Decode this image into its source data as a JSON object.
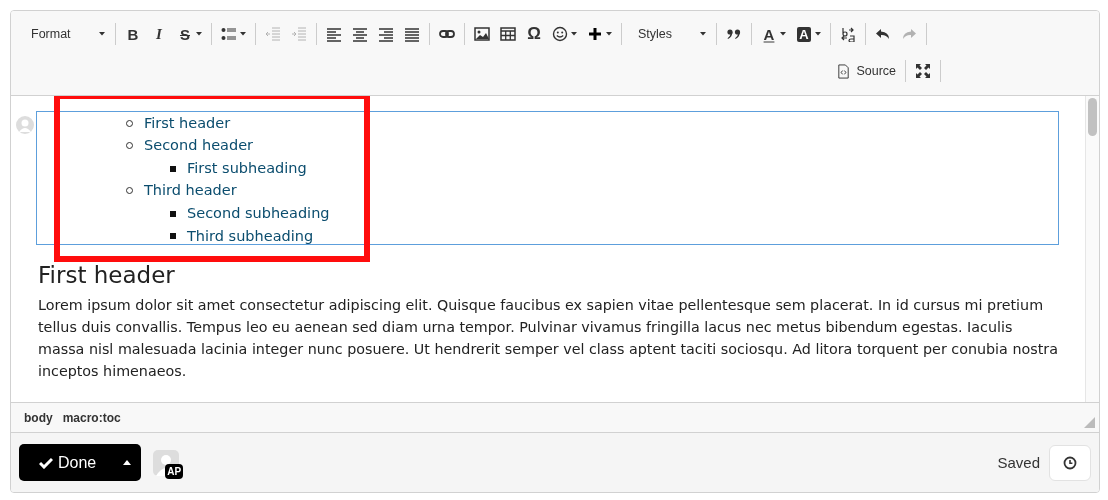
{
  "toolbar": {
    "rows": [
      [
        [
          {
            "kind": "dropdown",
            "label": "Format"
          }
        ],
        [
          {
            "kind": "glyph",
            "label": "B",
            "menu": false
          },
          {
            "kind": "glyph",
            "label": "I",
            "menu": false
          },
          {
            "kind": "glyph",
            "label": "S",
            "menu": true
          }
        ],
        [
          {
            "kind": "icon",
            "disabled": false,
            "menu": true
          }
        ],
        [
          {
            "kind": "icon",
            "disabled": true,
            "menu": false
          },
          {
            "kind": "icon",
            "disabled": true,
            "menu": false
          }
        ],
        [
          {
            "kind": "icon",
            "disabled": false,
            "menu": false
          },
          {
            "kind": "icon",
            "disabled": false,
            "menu": false
          },
          {
            "kind": "icon",
            "disabled": false,
            "menu": false
          },
          {
            "kind": "icon",
            "disabled": false,
            "menu": false
          }
        ],
        [
          {
            "kind": "icon",
            "disabled": false,
            "menu": false
          }
        ],
        [
          {
            "kind": "icon",
            "disabled": false,
            "menu": false
          },
          {
            "kind": "icon",
            "disabled": false,
            "menu": false
          },
          {
            "kind": "glyph",
            "label": "Ω",
            "menu": false
          },
          {
            "kind": "icon",
            "disabled": false,
            "menu": true
          },
          {
            "kind": "icon",
            "disabled": false,
            "menu": true
          }
        ],
        [
          {
            "kind": "dropdown",
            "label": "Styles"
          }
        ],
        [
          {
            "kind": "icon",
            "disabled": false,
            "menu": false
          }
        ],
        [
          {
            "kind": "glyph",
            "label": "A",
            "menu": true
          },
          {
            "kind": "glyph",
            "label": "A",
            "menu": true
          }
        ],
        [
          {
            "kind": "icon",
            "disabled": false,
            "menu": false
          }
        ],
        [
          {
            "kind": "icon",
            "disabled": false,
            "menu": false
          },
          {
            "kind": "icon",
            "disabled": true,
            "menu": false
          }
        ]
      ],
      [
        [
          {
            "kind": "labeled",
            "label": "Source"
          }
        ],
        [
          {
            "kind": "icon",
            "disabled": false,
            "menu": false
          }
        ]
      ]
    ]
  },
  "content": {
    "toc": [
      {
        "text": "First header"
      },
      {
        "text": "Second header",
        "children": [
          {
            "text": "First subheading"
          }
        ]
      },
      {
        "text": "Third header",
        "children": [
          {
            "text": "Second subheading"
          },
          {
            "text": "Third subheading"
          }
        ]
      }
    ],
    "heading": "First header",
    "paragraph": "Lorem ipsum dolor sit amet consectetur adipiscing elit. Quisque faucibus ex sapien vitae pellentesque sem placerat. In id cursus mi pretium tellus duis convallis. Tempus leo eu aenean sed diam urna tempor. Pulvinar vivamus fringilla lacus nec metus bibendum egestas. Iaculis massa nisl malesuada lacinia integer nunc posuere. Ut hendrerit semper vel class aptent taciti sociosqu. Ad litora torquent per conubia nostra inceptos himenaeos.",
    "annotations": [
      {
        "kind": "rectangle"
      }
    ]
  },
  "path_bar": [
    "body",
    "macro:toc"
  ],
  "footer": {
    "done_button": "Done",
    "avatar_badge": "AP",
    "status": "Saved"
  }
}
